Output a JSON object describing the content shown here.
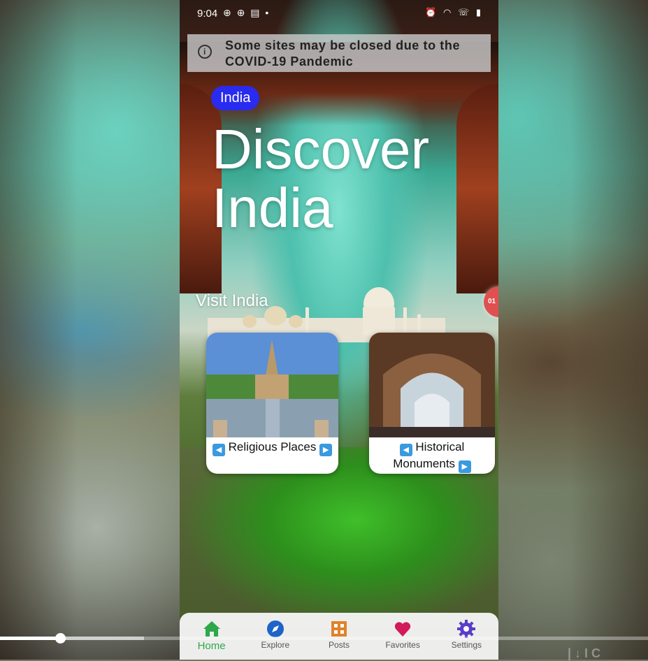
{
  "status_bar": {
    "time": "9:04",
    "left_icons": "⊕ ⊕ ▤ •",
    "right_icons": "⏰ ◠ ☏ ▮"
  },
  "banner": {
    "icon": "info-icon",
    "text": "Some sites may be closed due to the COVID-19 Pandemic"
  },
  "country_chip": "India",
  "hero": {
    "title_line1": "Discover",
    "title_line2": "India"
  },
  "section": {
    "label": "Visit India"
  },
  "pager_badge": "01",
  "cards": [
    {
      "label": "Religious Places",
      "left_arrow": "◀",
      "right_arrow": "▶"
    },
    {
      "label_line1": "Historical",
      "label_line2": "Monuments",
      "left_arrow": "◀",
      "right_arrow": "▶"
    }
  ],
  "bottom_nav": [
    {
      "label": "Home",
      "icon": "home-icon",
      "color": "#2ea84a",
      "active": true
    },
    {
      "label": "Explore",
      "icon": "compass-icon",
      "color": "#1e64c8",
      "active": false
    },
    {
      "label": "Posts",
      "icon": "posts-icon",
      "color": "#e0832a",
      "active": false
    },
    {
      "label": "Favorites",
      "icon": "heart-icon",
      "color": "#d11a5a",
      "active": false
    },
    {
      "label": "Settings",
      "icon": "gear-icon",
      "color": "#5a3dc8",
      "active": false
    }
  ],
  "video": {
    "progress": 0.093,
    "buffered": 0.222
  },
  "colors": {
    "chip_bg": "#2a2bf0",
    "banner_bg": "#c8c8c8"
  }
}
